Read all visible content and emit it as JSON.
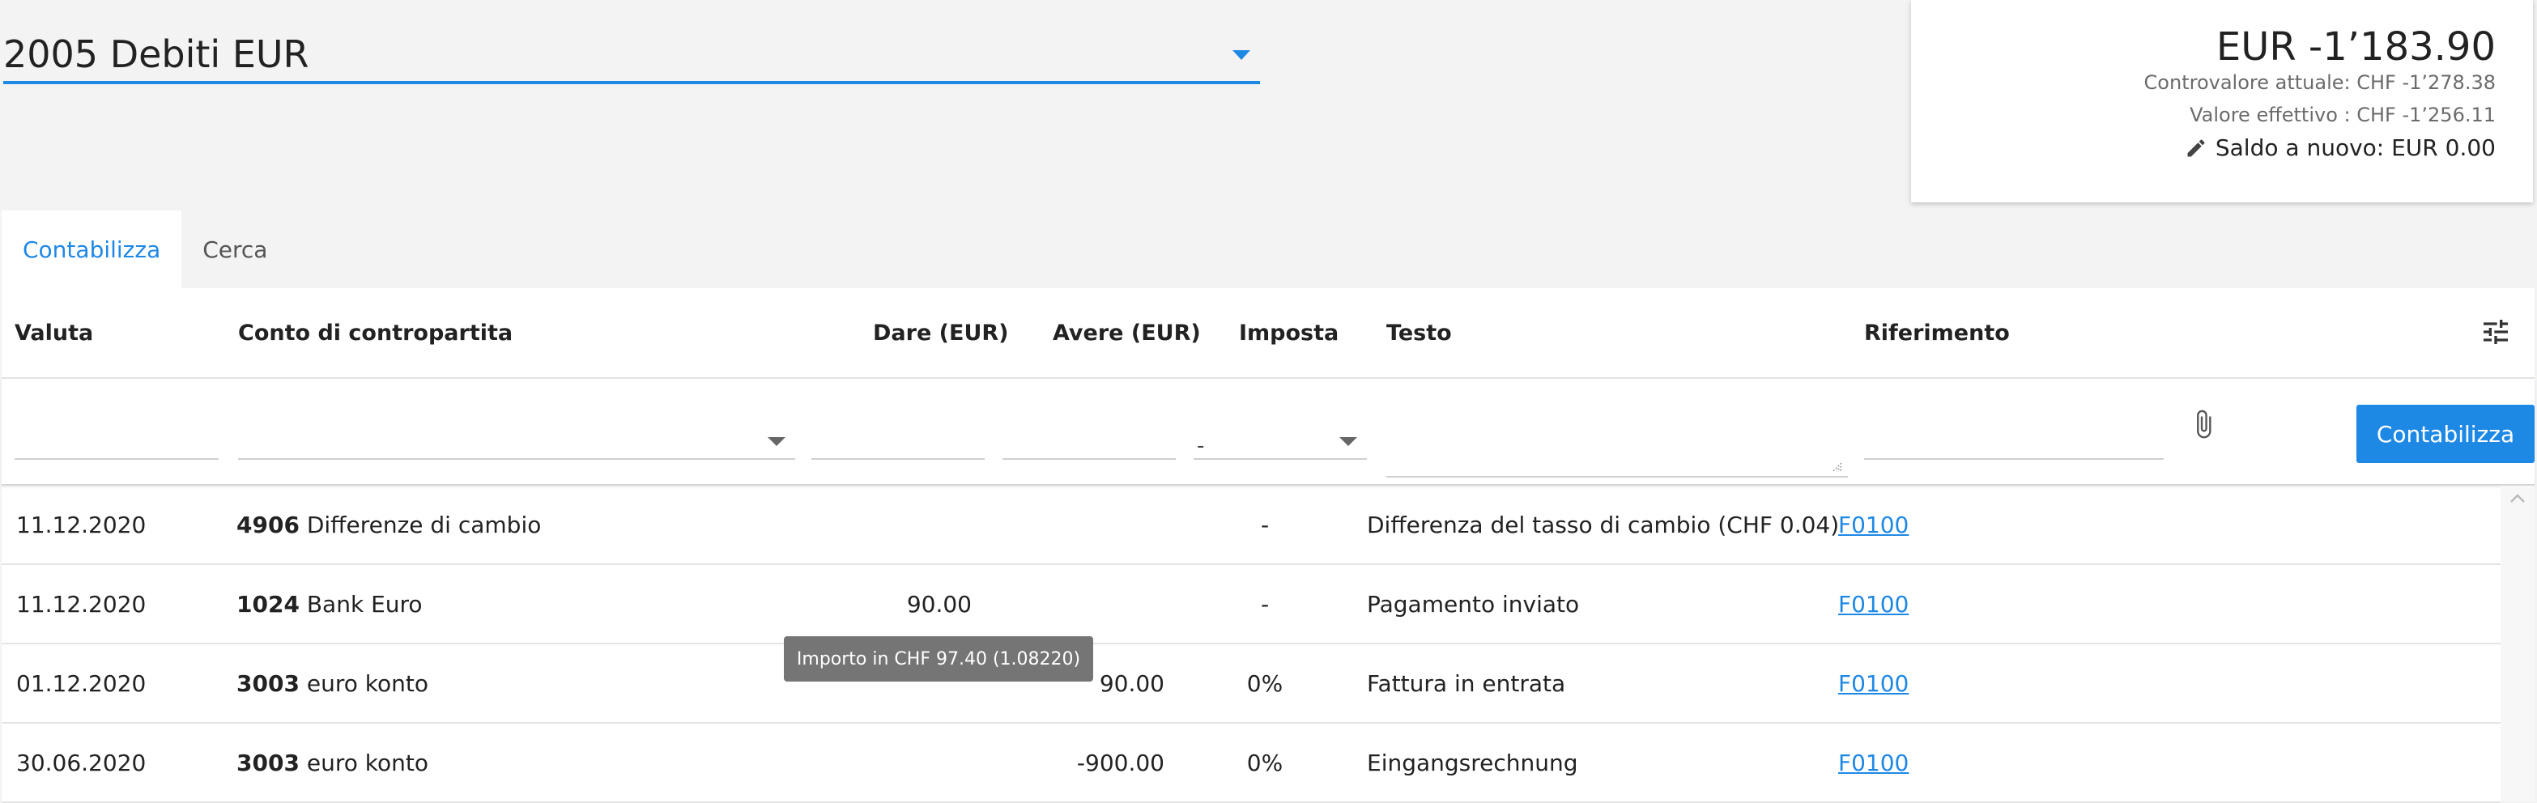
{
  "account_selector": {
    "value": "2005 Debiti EUR"
  },
  "balance": {
    "amount": "EUR -1’183.90",
    "current_value": "Controvalore attuale: CHF -1’278.38",
    "effective_value": "Valore effettivo : CHF -1’256.11",
    "carry_forward": "Saldo a nuovo: EUR 0.00"
  },
  "tabs": [
    {
      "label": "Contabilizza",
      "active": true
    },
    {
      "label": "Cerca",
      "active": false
    }
  ],
  "table": {
    "headers": {
      "date": "Valuta",
      "account": "Conto di contropartita",
      "debit": "Dare (EUR)",
      "credit": "Avere (EUR)",
      "tax": "Imposta",
      "text": "Testo",
      "reference": "Riferimento"
    },
    "entry": {
      "tax_value": "-",
      "post_label": "Contabilizza"
    },
    "rows": [
      {
        "date": "11.12.2020",
        "account_no": "4906",
        "account_name": "Differenze di cambio",
        "debit": "",
        "credit": "",
        "tax": "-",
        "text": "Differenza del tasso di cambio (CHF 0.04)",
        "ref": "F0100"
      },
      {
        "date": "11.12.2020",
        "account_no": "1024",
        "account_name": "Bank Euro",
        "debit": "90.00",
        "credit": "",
        "tax": "-",
        "text": "Pagamento inviato",
        "ref": "F0100"
      },
      {
        "date": "01.12.2020",
        "account_no": "3003",
        "account_name": "euro konto",
        "debit": "",
        "credit": "90.00",
        "tax": "0%",
        "text": "Fattura in entrata",
        "ref": "F0100"
      },
      {
        "date": "30.06.2020",
        "account_no": "3003",
        "account_name": "euro konto",
        "debit": "",
        "credit": "-900.00",
        "tax": "0%",
        "text": "Eingangsrechnung",
        "ref": "F0100"
      }
    ]
  },
  "tooltip": {
    "text": "Importo in CHF 97.40 (1.08220)"
  },
  "icons": {
    "settings": "tune-icon",
    "attach": "paperclip-icon",
    "edit": "pencil-icon"
  },
  "colors": {
    "accent": "#1e88e5",
    "tooltip_bg": "#757575"
  }
}
